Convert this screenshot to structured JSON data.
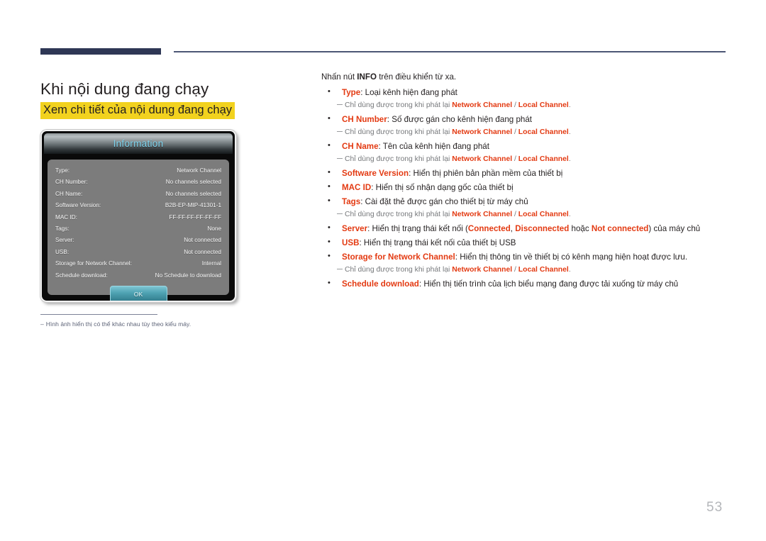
{
  "header": {
    "rule_color": "#2e3755"
  },
  "left": {
    "page_title": "Khi nội dung đang chạy",
    "sub_title": "Xem chi tiết của nội dung đang chạy",
    "footnote_dash": "‒",
    "footnote": "Hình ảnh hiển thị có thể khác nhau tùy theo kiểu máy."
  },
  "tv": {
    "title": "Information",
    "ok_label": "OK",
    "rows": [
      {
        "key": "Type:",
        "value": "Network Channel"
      },
      {
        "key": "CH Number:",
        "value": "No channels selected"
      },
      {
        "key": "CH Name:",
        "value": "No channels selected"
      },
      {
        "key": "Software Version:",
        "value": "B2B-EP-MIP-41301-1"
      },
      {
        "key": "MAC ID:",
        "value": "FF-FF-FF-FF-FF-FF"
      },
      {
        "key": "Tags:",
        "value": "None"
      },
      {
        "key": "Server:",
        "value": "Not connected"
      },
      {
        "key": "USB:",
        "value": "Not connected"
      },
      {
        "key": "Storage for Network Channel:",
        "value": "Internal"
      },
      {
        "key": "Schedule download:",
        "value": "No Schedule to download"
      }
    ]
  },
  "right": {
    "intro_before": "Nhấn nút ",
    "intro_bold": "INFO",
    "intro_after": " trên điều khiển từ xa.",
    "subnote_prefix": "Chỉ dùng được trong khi phát lại ",
    "subnote_a": "Network Channel",
    "subnote_sep": " / ",
    "subnote_b": "Local Channel",
    "subnote_suffix": ".",
    "items": [
      {
        "term": "Type",
        "desc": ": Loại kênh hiện đang phát",
        "has_subnote": true
      },
      {
        "term": "CH Number",
        "desc": ": Số được gán cho kênh hiện đang phát",
        "has_subnote": true
      },
      {
        "term": "CH Name",
        "desc": ": Tên của kênh hiện đang phát",
        "has_subnote": true
      },
      {
        "term": "Software Version",
        "desc": ": Hiển thị phiên bản phần mềm của thiết bị",
        "has_subnote": false
      },
      {
        "term": "MAC ID",
        "desc": ": Hiển thị số nhận dạng gốc của thiết bị",
        "has_subnote": false
      },
      {
        "term": "Tags",
        "desc": ": Cài đặt thẻ được gán cho thiết bị từ máy chủ",
        "has_subnote": true
      }
    ],
    "server_item": {
      "term": "Server",
      "part1": ": Hiển thị trạng thái kết nối (",
      "hl1": "Connected",
      "part2": ", ",
      "hl2": "Disconnected",
      "part3": " hoặc ",
      "hl3": "Not connected",
      "part4": ") của máy chủ"
    },
    "usb_item": {
      "term": "USB",
      "desc": ": Hiển thị trạng thái kết nối của thiết bị USB"
    },
    "storage_item": {
      "term": "Storage for Network Channel",
      "desc": ": Hiển thị thông tin về thiết bị có kênh mạng hiện hoạt được lưu."
    },
    "schedule_item": {
      "term": "Schedule download",
      "desc": ": Hiển thị tiến trình của lịch biểu mạng đang được tải xuống từ máy chủ"
    }
  },
  "page_number": "53",
  "colors": {
    "accent_red": "#e33a12",
    "highlight_yellow": "#f2d21e",
    "rule_navy": "#2e3755",
    "subnote_gray": "#77797c"
  }
}
